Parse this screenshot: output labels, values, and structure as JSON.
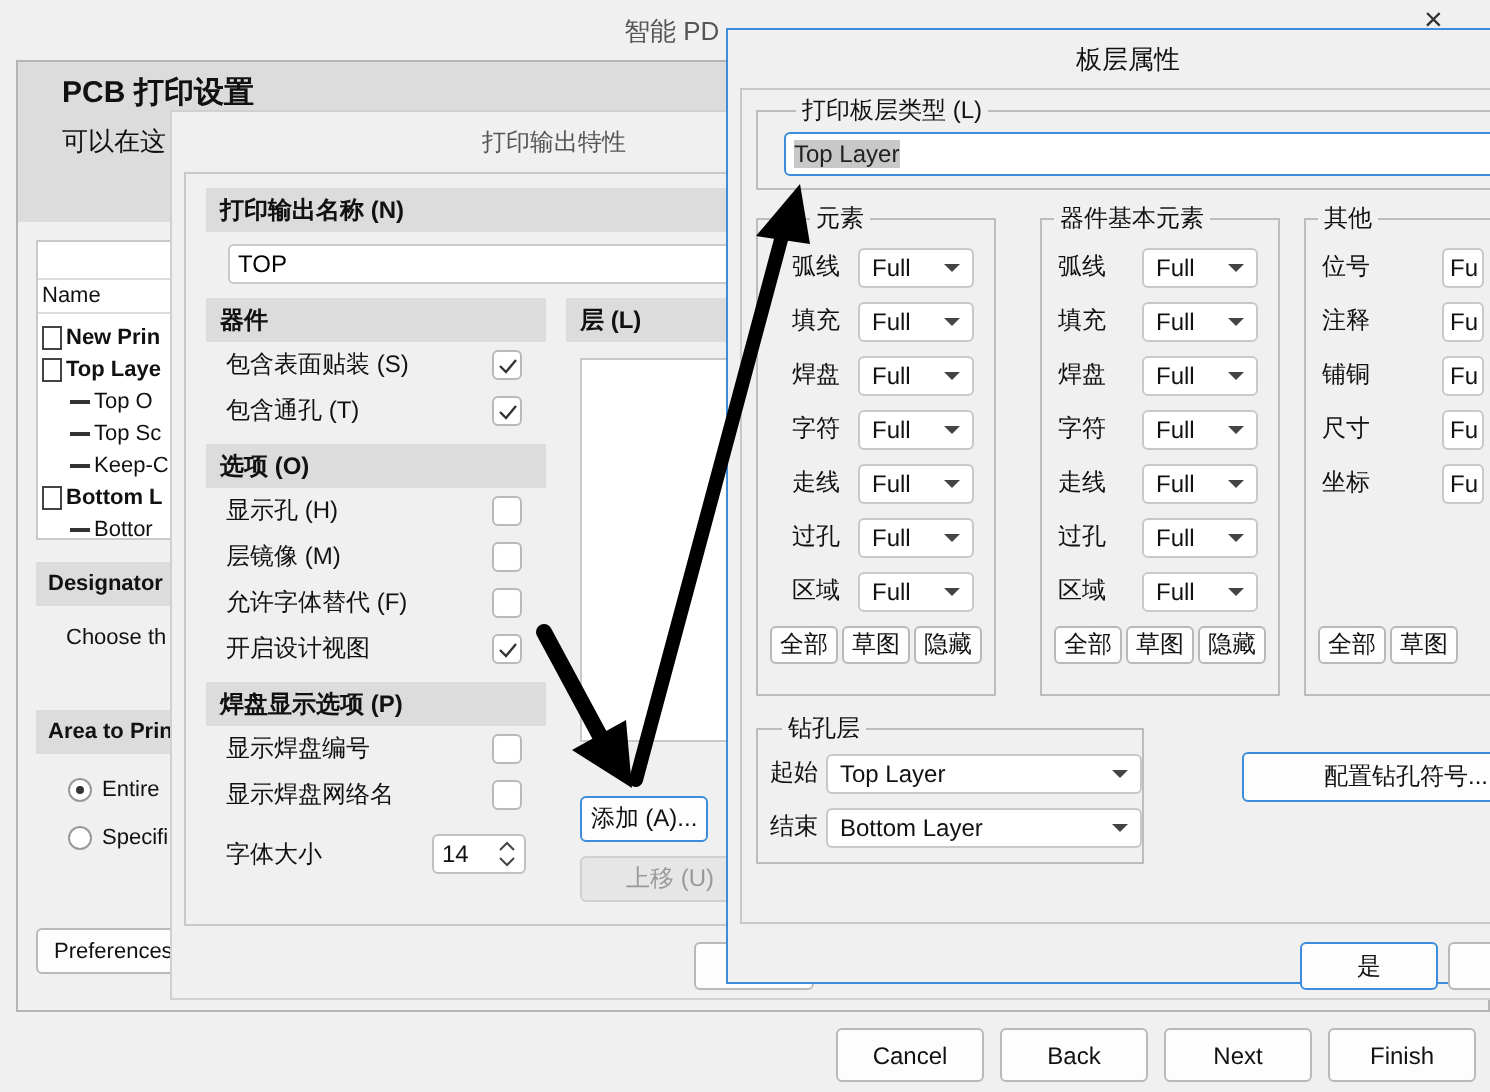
{
  "main_window": {
    "title": "智能 PD",
    "close": "×",
    "heading": "PCB 打印设置",
    "description": "可以在这",
    "tree": {
      "column": "Name",
      "items": [
        {
          "label": "New Prin",
          "kind": "document"
        },
        {
          "label": "Top Laye",
          "kind": "document",
          "children": [
            {
              "label": "Top O",
              "kind": "layer"
            },
            {
              "label": "Top Sc",
              "kind": "layer"
            },
            {
              "label": "Keep-C",
              "kind": "layer"
            }
          ]
        },
        {
          "label": "Bottom L",
          "kind": "document",
          "children": [
            {
              "label": "Bottor",
              "kind": "layer"
            }
          ]
        }
      ]
    },
    "designator": {
      "title": "Designator",
      "text": "Choose th"
    },
    "area": {
      "title": "Area to Prin",
      "options": [
        {
          "label": "Entire",
          "selected": true
        },
        {
          "label": "Specifi",
          "selected": false
        }
      ]
    },
    "preferences_button": "Preferences",
    "buttons": [
      "Cancel",
      "Back",
      "Next",
      "Finish"
    ]
  },
  "print_dialog": {
    "title": "打印输出特性",
    "name_label": "打印输出名称 (N)",
    "name_value": "TOP",
    "sections": [
      {
        "title": "器件",
        "rows": [
          {
            "kind": "checkbox",
            "label": "包含表面贴装 (S)",
            "checked": true
          },
          {
            "kind": "checkbox",
            "label": "包含通孔 (T)",
            "checked": true
          }
        ]
      },
      {
        "title": "选项 (O)",
        "rows": [
          {
            "kind": "checkbox",
            "label": "显示孔 (H)",
            "checked": false
          },
          {
            "kind": "checkbox",
            "label": "层镜像 (M)",
            "checked": false
          },
          {
            "kind": "checkbox",
            "label": "允许字体替代 (F)",
            "checked": false
          },
          {
            "kind": "checkbox",
            "label": "开启设计视图",
            "checked": true
          }
        ]
      },
      {
        "title": "焊盘显示选项 (P)",
        "rows": [
          {
            "kind": "checkbox",
            "label": "显示焊盘编号",
            "checked": false
          },
          {
            "kind": "checkbox",
            "label": "显示焊盘网络名",
            "checked": false
          },
          {
            "kind": "spinner",
            "label": "字体大小",
            "value": "14"
          }
        ]
      }
    ],
    "layers": {
      "title": "层 (L)",
      "buttons": [
        {
          "label": "添加 (A)...",
          "disabled": false
        },
        {
          "label": "上移 (U)",
          "disabled": true
        }
      ]
    }
  },
  "layer_dialog": {
    "title": "板层属性",
    "type_group": {
      "legend": "打印板层类型 (L)",
      "value": "Top Layer"
    },
    "groups": [
      {
        "legend": "元素",
        "rows": [
          {
            "label": "弧线",
            "value": "Full"
          },
          {
            "label": "填充",
            "value": "Full"
          },
          {
            "label": "焊盘",
            "value": "Full"
          },
          {
            "label": "字符",
            "value": "Full"
          },
          {
            "label": "走线",
            "value": "Full"
          },
          {
            "label": "过孔",
            "value": "Full"
          },
          {
            "label": "区域",
            "value": "Full"
          }
        ],
        "buttons": [
          "全部",
          "草图",
          "隐藏"
        ]
      },
      {
        "legend": "器件基本元素",
        "rows": [
          {
            "label": "弧线",
            "value": "Full"
          },
          {
            "label": "填充",
            "value": "Full"
          },
          {
            "label": "焊盘",
            "value": "Full"
          },
          {
            "label": "字符",
            "value": "Full"
          },
          {
            "label": "走线",
            "value": "Full"
          },
          {
            "label": "过孔",
            "value": "Full"
          },
          {
            "label": "区域",
            "value": "Full"
          }
        ],
        "buttons": [
          "全部",
          "草图",
          "隐藏"
        ]
      },
      {
        "legend": "其他",
        "rows": [
          {
            "label": "位号",
            "value": "Fu"
          },
          {
            "label": "注释",
            "value": "Fu"
          },
          {
            "label": "铺铜",
            "value": "Fu"
          },
          {
            "label": "尺寸",
            "value": "Fu"
          },
          {
            "label": "坐标",
            "value": "Fu"
          }
        ],
        "buttons": [
          "全部",
          "草图"
        ]
      }
    ],
    "drill": {
      "legend": "钻孔层",
      "rows": [
        {
          "label": "起始",
          "value": "Top Layer"
        },
        {
          "label": "结束",
          "value": "Bottom Layer"
        }
      ]
    },
    "drill_button": "配置钻孔符号...",
    "ok_button": "是"
  }
}
